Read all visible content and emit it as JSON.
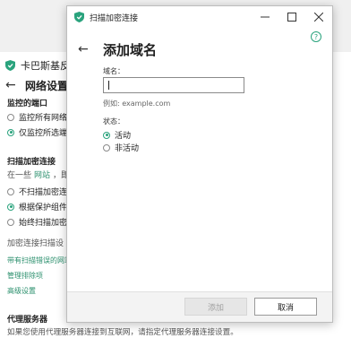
{
  "background": {
    "app_title": "卡巴斯基反病",
    "page_title": "网络设置",
    "section_top": "监控的端口",
    "port_option_1": "监控所有网络",
    "port_option_2": "仅监控所选端",
    "encrypted_section": "扫描加密连接",
    "encrypted_desc_prefix": "在一些",
    "encrypted_desc_link": "网站",
    "encrypted_desc_suffix": "，即使",
    "enc_option_1": "不扫描加密连",
    "enc_option_2": "根据保护组件",
    "enc_option_3": "始终扫描加密",
    "scan_settings": "加密连接扫描设",
    "link_1": "带有扫描错误的网站",
    "link_2": "管理排除项",
    "link_3": "高级设置",
    "proxy_title": "代理服务器",
    "proxy_desc": "如果您使用代理服务器连接到互联网，请指定代理服务器连接设置。"
  },
  "dialog": {
    "window_title": "扫描加密连接",
    "heading": "添加域名",
    "domain_label": "域名：",
    "domain_value": "",
    "example": "例如: example.com",
    "status_label": "状态：",
    "status_active": "活动",
    "status_inactive": "非活动",
    "add_button": "添加",
    "cancel_button": "取消",
    "help_glyph": "?"
  },
  "colors": {
    "accent": "#2aa37d",
    "link": "#2a8f6c"
  }
}
